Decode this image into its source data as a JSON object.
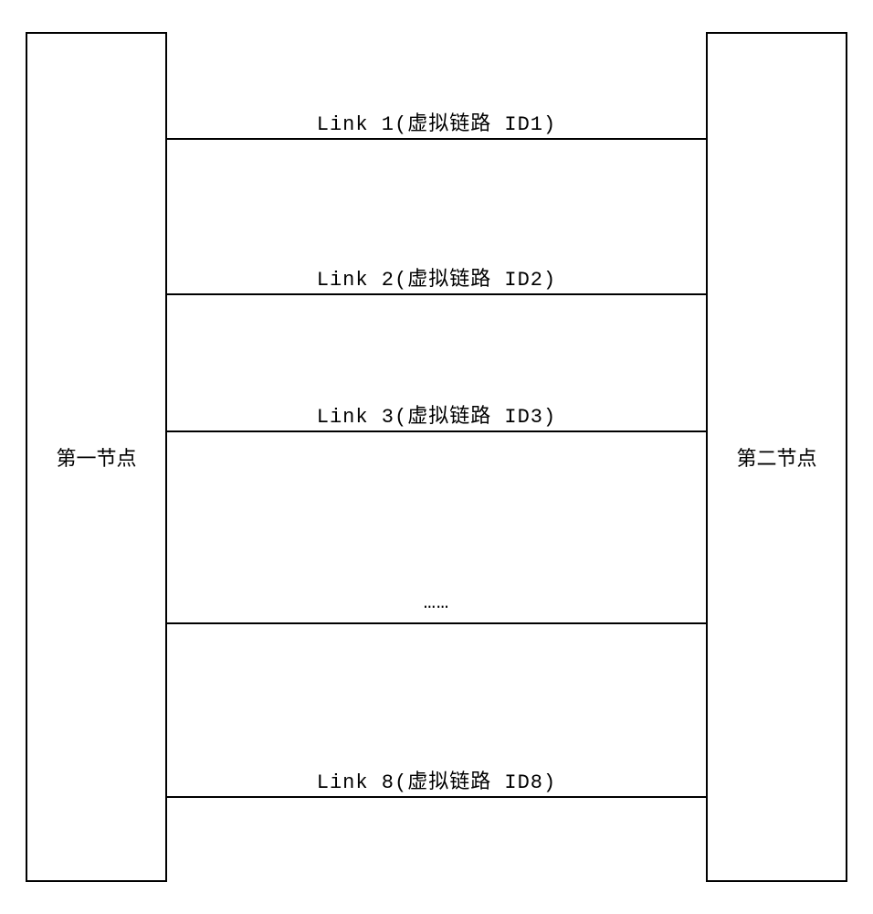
{
  "nodes": {
    "left": "第一节点",
    "right": "第二节点"
  },
  "links": {
    "l1": "Link 1(虚拟链路 ID1)",
    "l2": "Link 2(虚拟链路 ID2)",
    "l3": "Link 3(虚拟链路 ID3)",
    "ellipsis": "……",
    "l8": "Link 8(虚拟链路 ID8)"
  }
}
